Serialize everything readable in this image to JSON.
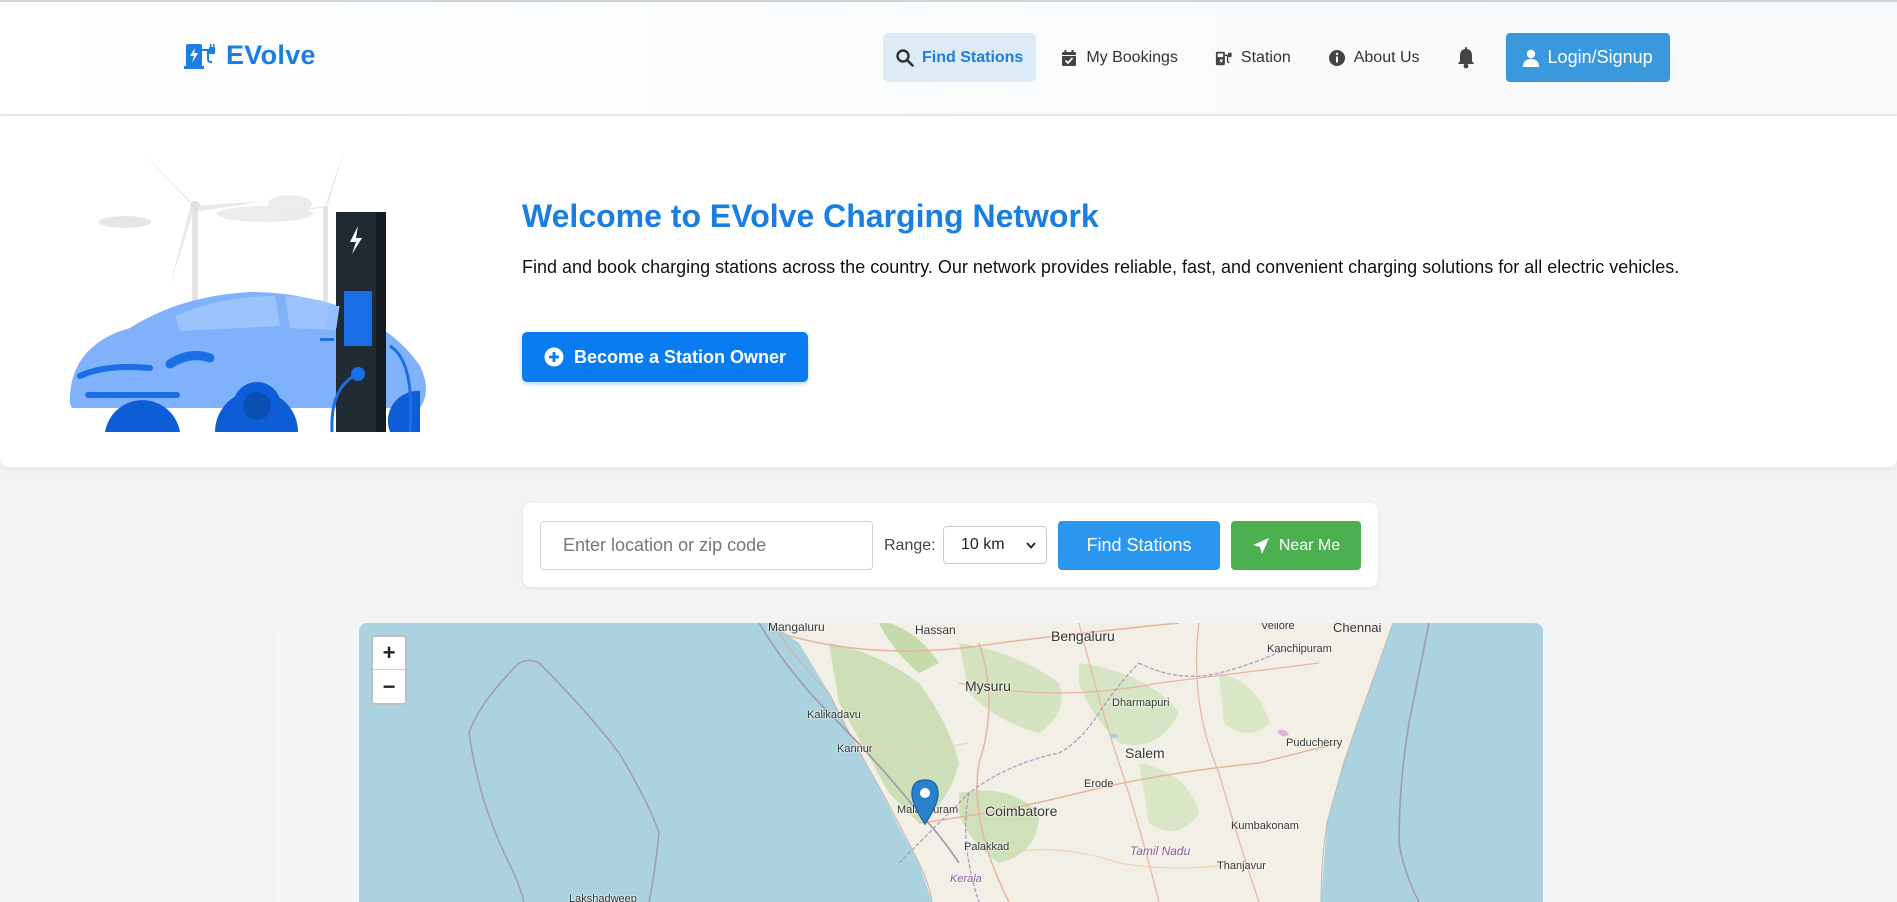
{
  "brand": {
    "name": "EVolve"
  },
  "nav": {
    "items": [
      {
        "label": "Find Stations",
        "active": true,
        "icon": "search-icon"
      },
      {
        "label": "My Bookings",
        "active": false,
        "icon": "calendar-check-icon"
      },
      {
        "label": "Station",
        "active": false,
        "icon": "charging-station-icon"
      },
      {
        "label": "About Us",
        "active": false,
        "icon": "info-icon"
      }
    ],
    "bell_icon": "bell-icon",
    "login_label": "Login/Signup"
  },
  "hero": {
    "title": "Welcome to EVolve Charging Network",
    "description": "Find and book charging stations across the country. Our network provides reliable, fast, and convenient charging solutions for all electric vehicles.",
    "owner_button": "Become a Station Owner"
  },
  "search": {
    "placeholder": "Enter location or zip code",
    "value": "",
    "range_label": "Range:",
    "range_value": "10 km",
    "find_button": "Find Stations",
    "near_button": "Near Me"
  },
  "map": {
    "zoom_in": "+",
    "zoom_out": "−",
    "places": [
      "Mangaluru",
      "Hassan",
      "Bengaluru",
      "Vellore",
      "Chennai",
      "Kanchipuram",
      "Mysuru",
      "Dharmapuri",
      "Kalikadavu",
      "Kannur",
      "Salem",
      "Puducherry",
      "Erode",
      "Malappuram",
      "Coimbatore",
      "Kumbakonam",
      "Palakkad",
      "Tamil Nadu",
      "Thanjavur",
      "Kerala",
      "Lakshadweep"
    ]
  },
  "colors": {
    "brand": "#1a7fe0",
    "primary_button": "#0a7cf2",
    "find_button": "#2a96ef",
    "near_button": "#4caf50",
    "login": "#3a99dc"
  }
}
